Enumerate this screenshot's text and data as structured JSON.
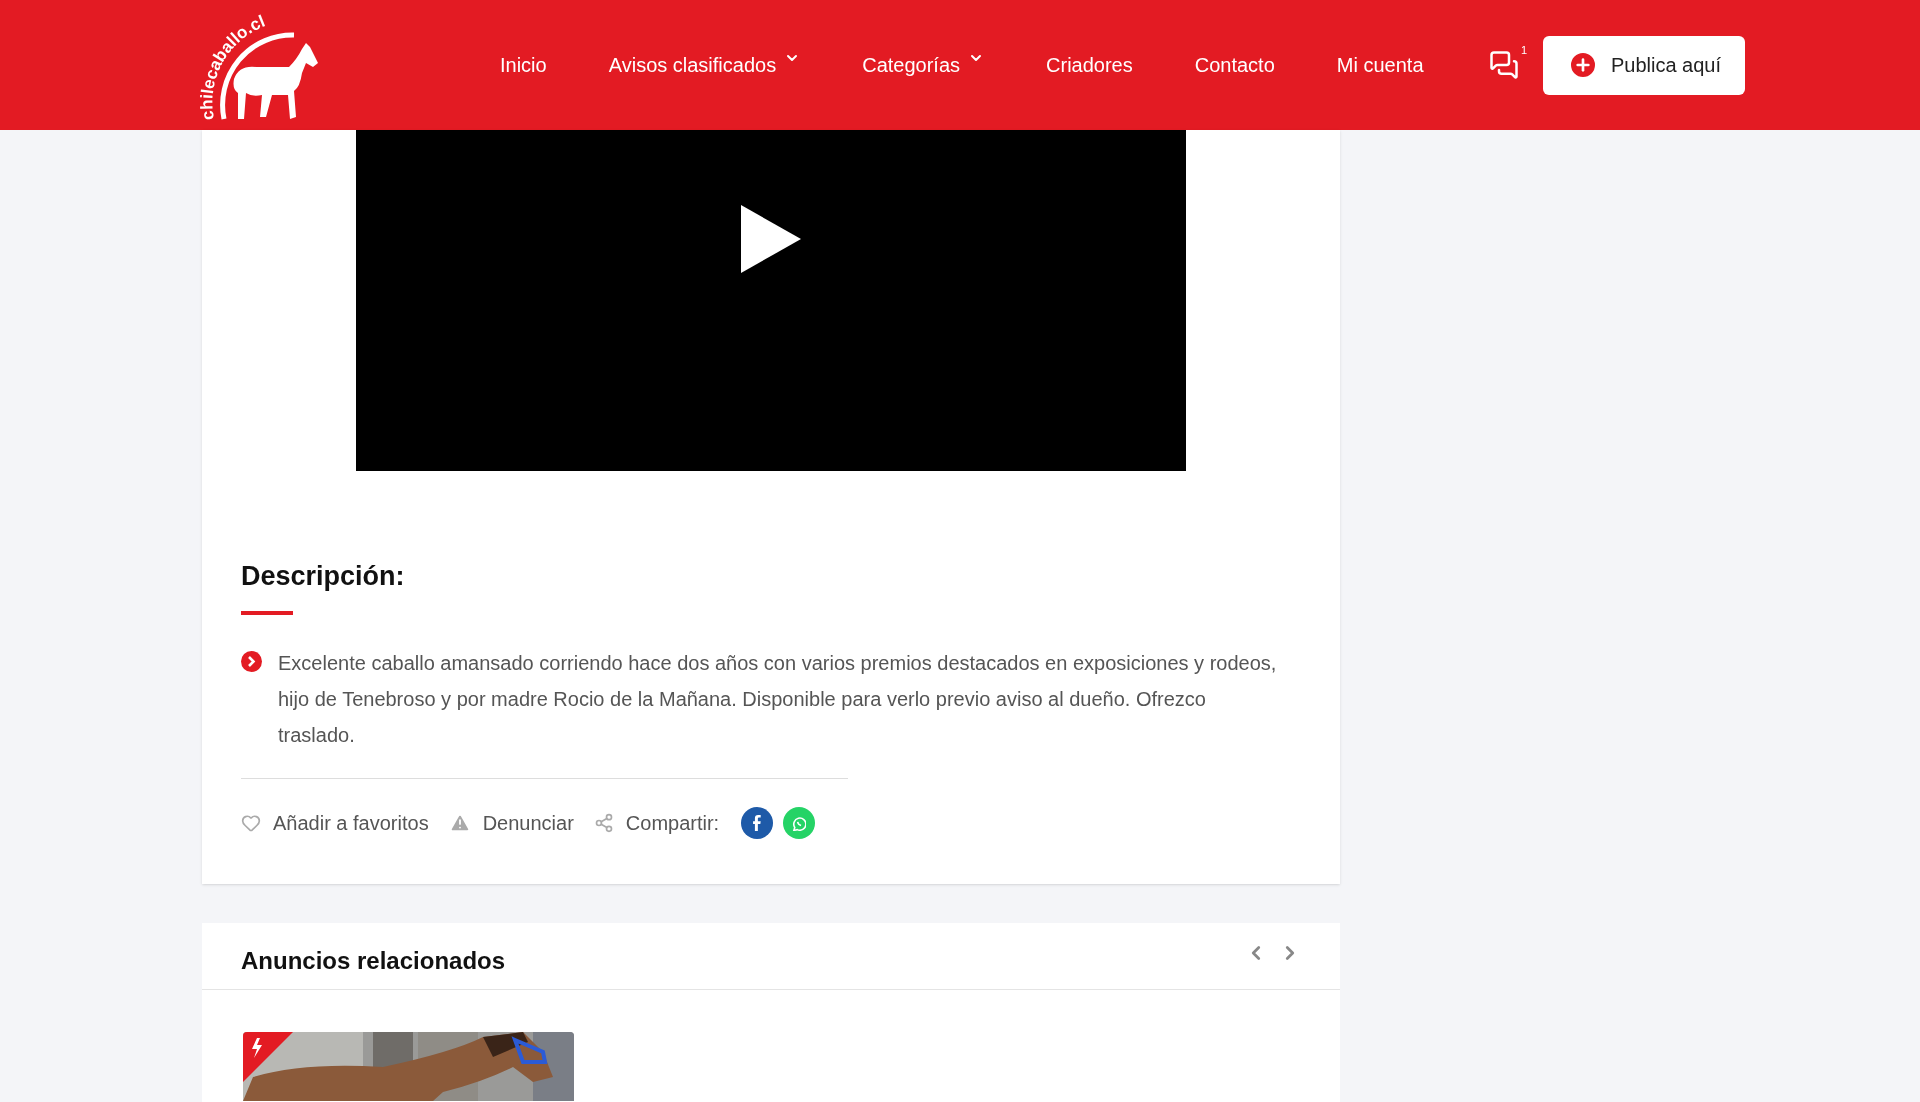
{
  "header": {
    "logo_text": "chilecaballo.cl",
    "nav": [
      {
        "label": "Inicio",
        "dropdown": false
      },
      {
        "label": "Avisos clasificados",
        "dropdown": true
      },
      {
        "label": "Categorías",
        "dropdown": true
      },
      {
        "label": "Criadores",
        "dropdown": false
      },
      {
        "label": "Contacto",
        "dropdown": false
      },
      {
        "label": "Mi cuenta",
        "dropdown": false
      }
    ],
    "messages_count": "1",
    "publish_button": "Publica aquí"
  },
  "listing": {
    "description_title": "Descripción:",
    "description_items": [
      "Excelente caballo amansado corriendo hace dos años con varios premios destacados en exposiciones y rodeos, hijo de Tenebroso y por madre Rocio de la Mañana. Disponible para verlo previo aviso al dueño. Ofrezco traslado."
    ],
    "actions": [
      {
        "kind": "favorite",
        "label": "Añadir a favoritos"
      },
      {
        "kind": "report",
        "label": "Denunciar"
      },
      {
        "kind": "share",
        "label": "Compartir:"
      }
    ],
    "share_networks": [
      {
        "kind": "facebook",
        "color": "#1e5aa8"
      },
      {
        "kind": "whatsapp",
        "color": "#25d366"
      }
    ]
  },
  "related": {
    "title": "Anuncios relacionados",
    "cards": [
      {
        "kind": "picture",
        "featured": true
      }
    ]
  }
}
